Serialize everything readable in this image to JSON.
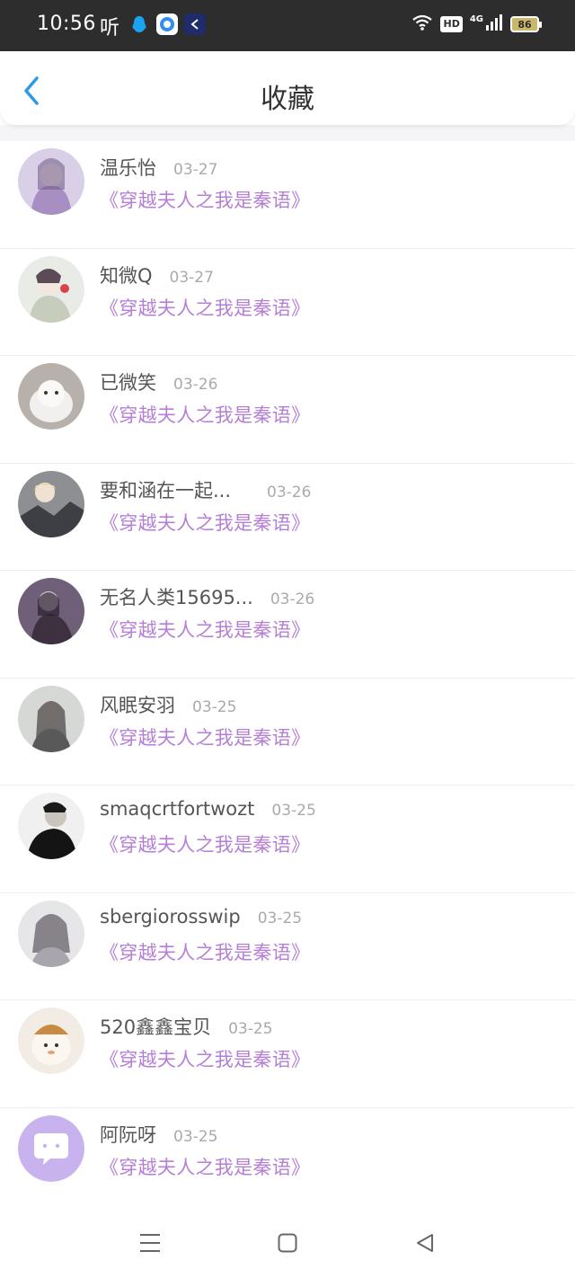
{
  "status_bar": {
    "time": "10:56",
    "ting": "听",
    "hd": "HD",
    "network": "4G",
    "battery": "86"
  },
  "header": {
    "title": "收藏"
  },
  "favorites": [
    {
      "name": "温乐怡",
      "date": "03-27",
      "novel": "《穿越夫人之我是秦语》"
    },
    {
      "name": "知微Q",
      "date": "03-27",
      "novel": "《穿越夫人之我是秦语》"
    },
    {
      "name": "已微笑",
      "date": "03-26",
      "novel": "《穿越夫人之我是秦语》"
    },
    {
      "name": "要和涵在一起...",
      "date": "03-26",
      "novel": "《穿越夫人之我是秦语》"
    },
    {
      "name": "无名人类15695...",
      "date": "03-26",
      "novel": "《穿越夫人之我是秦语》"
    },
    {
      "name": "风眠安羽",
      "date": "03-25",
      "novel": "《穿越夫人之我是秦语》"
    },
    {
      "name": "smaqcrtfortwozt",
      "date": "03-25",
      "novel": "《穿越夫人之我是秦语》"
    },
    {
      "name": "sbergiorosswip",
      "date": "03-25",
      "novel": "《穿越夫人之我是秦语》"
    },
    {
      "name": "520鑫鑫宝贝",
      "date": "03-25",
      "novel": "《穿越夫人之我是秦语》"
    },
    {
      "name": "阿阮呀",
      "date": "03-25",
      "novel": "《穿越夫人之我是秦语》"
    }
  ],
  "colors": {
    "accent_back": "#2e9ae6",
    "novel_link": "#b57fd6",
    "status_bar_bg": "#2d2d2d"
  },
  "nav_bar": {
    "icons": [
      "menu-icon",
      "home-icon",
      "back-triangle-icon"
    ]
  }
}
